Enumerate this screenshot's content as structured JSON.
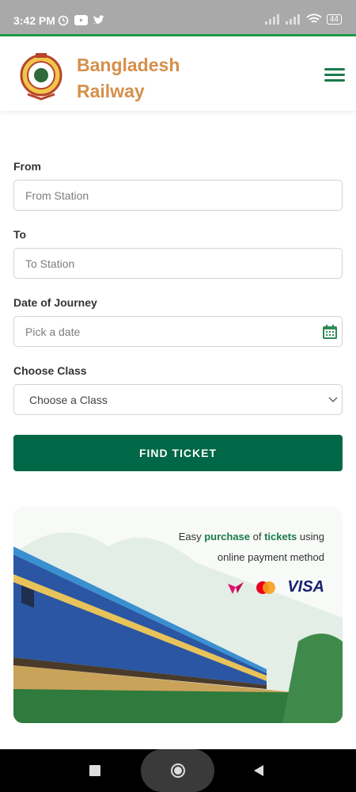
{
  "status_bar": {
    "time": "3:42 PM",
    "battery": "44"
  },
  "header": {
    "brand_line1": "Bangladesh",
    "brand_line2": "Railway"
  },
  "form": {
    "from_label": "From",
    "from_placeholder": "From Station",
    "to_label": "To",
    "to_placeholder": "To Station",
    "date_label": "Date of Journey",
    "date_placeholder": "Pick a date",
    "class_label": "Choose Class",
    "class_selected": "Choose a Class"
  },
  "find_button": "FIND TICKET",
  "banner": {
    "text1_a": "Easy ",
    "text1_b": "purchase",
    "text1_c": " of ",
    "text1_d": "tickets",
    "text1_e": " using",
    "text2": "online payment method",
    "visa": "VISA"
  },
  "colors": {
    "accent": "#006747",
    "brand": "#d68f4a",
    "status_bar": "#a9a9a9"
  }
}
